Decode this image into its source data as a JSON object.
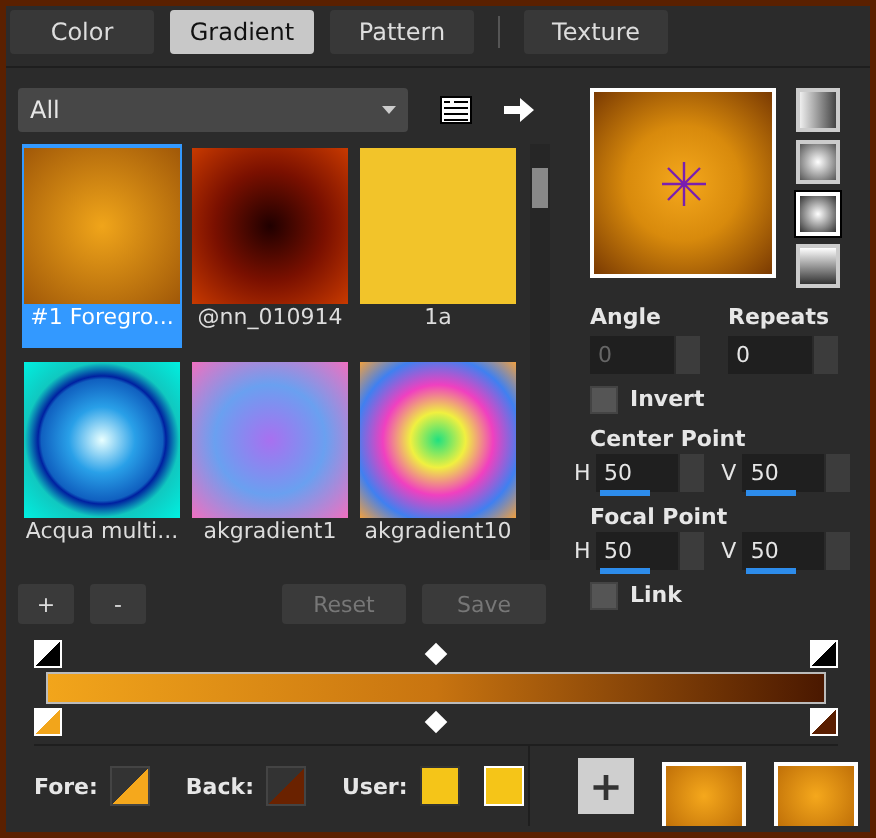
{
  "tabs": [
    {
      "label": "Color",
      "selected": false
    },
    {
      "label": "Gradient",
      "selected": true
    },
    {
      "label": "Pattern",
      "selected": false
    },
    {
      "label": "Texture",
      "selected": false
    }
  ],
  "category": {
    "value": "All"
  },
  "gradients": [
    {
      "label": "#1 Foregro...",
      "selected": true
    },
    {
      "label": "@nn_010914",
      "selected": false
    },
    {
      "label": "1a",
      "selected": false
    },
    {
      "label": "Acqua multi...",
      "selected": false
    },
    {
      "label": "akgradient1",
      "selected": false
    },
    {
      "label": "akgradient10",
      "selected": false
    }
  ],
  "list_buttons": [
    {
      "label": "+",
      "disabled": false
    },
    {
      "label": "-",
      "disabled": false
    },
    {
      "label": "Reset",
      "disabled": true
    },
    {
      "label": "Save",
      "disabled": true
    }
  ],
  "styles": [
    {
      "selected": false
    },
    {
      "selected": false
    },
    {
      "selected": true
    },
    {
      "selected": false
    }
  ],
  "angle": {
    "label": "Angle",
    "value": "0",
    "disabled": true
  },
  "repeats": {
    "label": "Repeats",
    "value": "0",
    "disabled": false
  },
  "invert": {
    "label": "Invert",
    "checked": false
  },
  "center_point": {
    "label": "Center Point",
    "h": {
      "label": "H",
      "value": "50",
      "level": 0.5
    },
    "v": {
      "label": "V",
      "value": "50",
      "level": 0.5
    }
  },
  "focal_point": {
    "label": "Focal Point",
    "h": {
      "label": "H",
      "value": "50",
      "level": 0.5
    },
    "v": {
      "label": "V",
      "value": "50",
      "level": 0.5
    }
  },
  "link": {
    "label": "Link",
    "checked": false
  },
  "footer": {
    "fore": "Fore:",
    "back": "Back:",
    "user": "User:",
    "add": "+"
  }
}
